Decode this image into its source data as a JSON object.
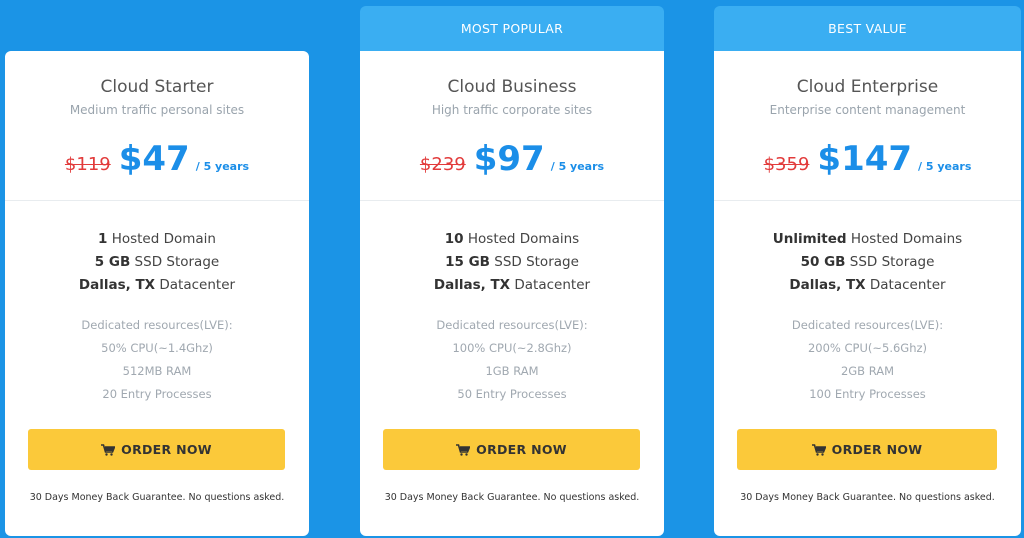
{
  "plans": [
    {
      "name": "Cloud Starter",
      "subtitle": "Medium traffic personal sites",
      "old_price": "$119",
      "price": "$47",
      "period": "/ 5 years",
      "features": [
        {
          "bold": "1",
          "text": " Hosted Domain"
        },
        {
          "bold": "5 GB",
          "text": " SSD Storage"
        },
        {
          "bold": "Dallas, TX",
          "text": " Datacenter"
        }
      ],
      "resources": [
        "Dedicated resources(LVE):",
        "50% CPU(~1.4Ghz)",
        "512MB RAM",
        "20 Entry Processes"
      ],
      "button_label": "ORDER NOW",
      "guarantee": "30 Days Money Back Guarantee. No questions asked."
    },
    {
      "ribbon": "MOST POPULAR",
      "name": "Cloud Business",
      "subtitle": "High traffic corporate sites",
      "old_price": "$239",
      "price": "$97",
      "period": "/ 5 years",
      "features": [
        {
          "bold": "10",
          "text": " Hosted Domains"
        },
        {
          "bold": "15 GB",
          "text": " SSD Storage"
        },
        {
          "bold": "Dallas, TX",
          "text": " Datacenter"
        }
      ],
      "resources": [
        "Dedicated resources(LVE):",
        "100% CPU(~2.8Ghz)",
        "1GB RAM",
        "50 Entry Processes"
      ],
      "button_label": "ORDER NOW",
      "guarantee": "30 Days Money Back Guarantee. No questions asked."
    },
    {
      "ribbon": "BEST VALUE",
      "name": "Cloud Enterprise",
      "subtitle": "Enterprise content management",
      "old_price": "$359",
      "price": "$147",
      "period": "/ 5 years",
      "features": [
        {
          "bold": "Unlimited",
          "text": " Hosted Domains"
        },
        {
          "bold": "50 GB",
          "text": " SSD Storage"
        },
        {
          "bold": "Dallas, TX",
          "text": " Datacenter"
        }
      ],
      "resources": [
        "Dedicated resources(LVE):",
        "200% CPU(~5.6Ghz)",
        "2GB RAM",
        "100 Entry Processes"
      ],
      "button_label": "ORDER NOW",
      "guarantee": "30 Days Money Back Guarantee. No questions asked."
    }
  ],
  "icons": {
    "order_button": "cart-icon"
  },
  "colors": {
    "background": "#1b94e6",
    "ribbon": "#3aaef2",
    "price": "#1b8ee8",
    "old_price": "#e23b3b",
    "button": "#fbc93a"
  }
}
